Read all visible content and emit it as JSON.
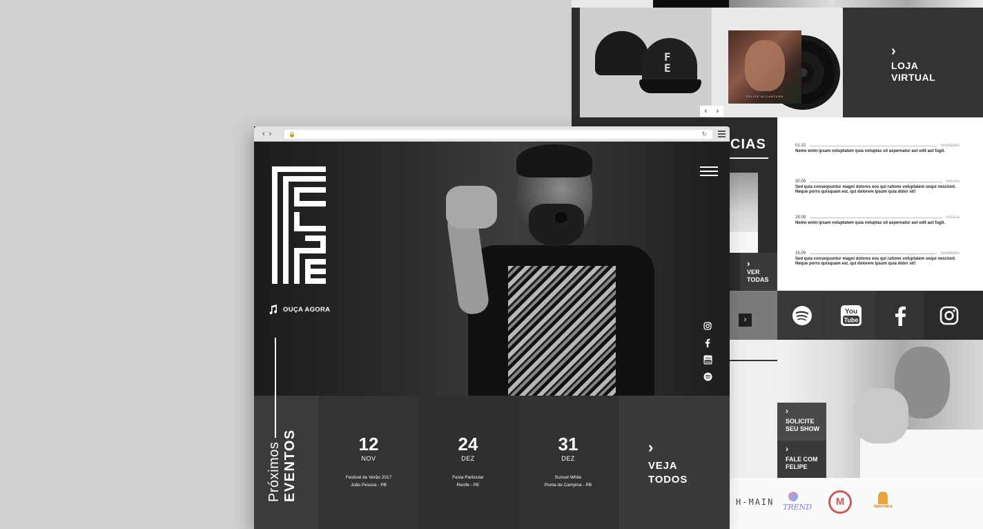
{
  "back_page": {
    "shop": {
      "store_label_line1": "LOJA",
      "store_label_line2": "VIRTUAL",
      "vinyl_caption": "FELIPE ALCANTARA",
      "prev_arrow": "‹",
      "next_arrow": "›"
    },
    "news": {
      "title_fragment": "CIAS",
      "ver_todas_line1": "VER",
      "ver_todas_line2": "TODAS",
      "items": [
        {
          "date": "01.10",
          "category": "novidades",
          "text": "Nemo enim ipsam voluptatem quia voluptas sit aspernatur aut odit aut fugit."
        },
        {
          "date": "30.09",
          "category": "música",
          "text": "Sed quia consequuntur magni dolores eos qui ratione voluptatem sequi nesciunt. Neque porro quisquam est, qui dolorem ipsum quia dolor sit!"
        },
        {
          "date": "28.09",
          "category": "música",
          "text": "Nemo enim ipsam voluptatem quia voluptas sit aspernatur aut odit aut fugit."
        },
        {
          "date": "15.09",
          "category": "novidades",
          "text": "Sed quia consequuntur magni dolores eos qui ratione voluptatem sequi nesciunt. Neque porro quisquam est, qui dolorem ipsum quia dolor sit!"
        }
      ]
    },
    "social_icons": [
      "spotify-icon",
      "youtube-icon",
      "facebook-icon",
      "instagram-icon"
    ],
    "cta": {
      "solicite_line1": "SOLICITE",
      "solicite_line2": "SEU SHOW",
      "fale_line1": "FALE COM",
      "fale_line2": "FELIPE"
    },
    "partners": [
      "H-MAIN",
      "TREND",
      "M",
      "talentos"
    ]
  },
  "browser": {
    "nav_back": "‹",
    "nav_forward": "›"
  },
  "hero": {
    "listen_label": "OUÇA AGORA",
    "side_social": [
      "instagram-icon",
      "facebook-icon",
      "youtube-icon",
      "spotify-icon"
    ]
  },
  "events": {
    "label_light": "Próximos",
    "label_bold": "EVENTOS",
    "items": [
      {
        "day": "12",
        "month": "NOV",
        "title": "Festival de Verão 2017",
        "place": "João Pessoa - PB"
      },
      {
        "day": "24",
        "month": "DEZ",
        "title": "Festa Particular",
        "place": "Recife - PE"
      },
      {
        "day": "31",
        "month": "DEZ",
        "title": "Sunset White",
        "place": "Ponta de Campina - PB"
      }
    ],
    "see_all_line1": "VEJA",
    "see_all_line2": "TODOS"
  },
  "colors": {
    "background": "#d0d1cf",
    "dark_panel": "#2e2e2e",
    "event_bar": "#303030",
    "white": "#ffffff"
  }
}
